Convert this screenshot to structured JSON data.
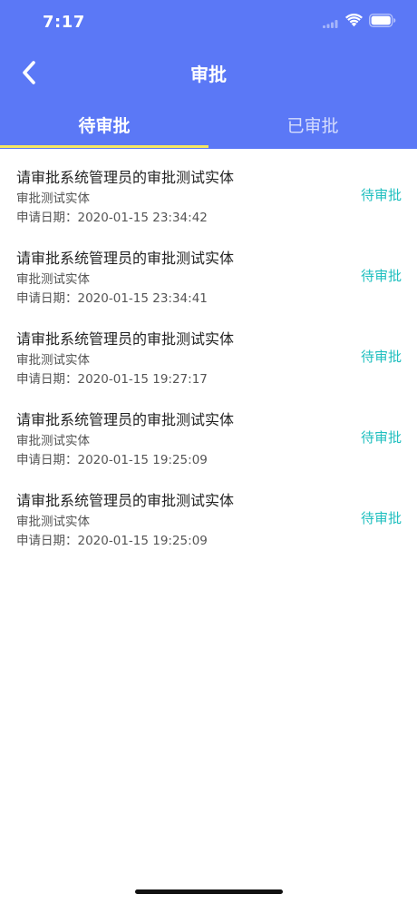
{
  "status_bar": {
    "time": "7:17"
  },
  "header": {
    "title": "审批",
    "back_icon": "chevron-left-icon"
  },
  "tabs": [
    {
      "label": "待审批",
      "active": true
    },
    {
      "label": "已审批",
      "active": false
    }
  ],
  "colors": {
    "header_bg": "#5b78f6",
    "tab_indicator": "#f5e663",
    "status_text": "#1fbfbf"
  },
  "items": [
    {
      "title": "请审批系统管理员的审批测试实体",
      "subtitle": "审批测试实体",
      "date": "申请日期：2020-01-15 23:34:42",
      "status": "待审批"
    },
    {
      "title": "请审批系统管理员的审批测试实体",
      "subtitle": "审批测试实体",
      "date": "申请日期：2020-01-15 23:34:41",
      "status": "待审批"
    },
    {
      "title": "请审批系统管理员的审批测试实体",
      "subtitle": "审批测试实体",
      "date": "申请日期：2020-01-15 19:27:17",
      "status": "待审批"
    },
    {
      "title": "请审批系统管理员的审批测试实体",
      "subtitle": "审批测试实体",
      "date": "申请日期：2020-01-15 19:25:09",
      "status": "待审批"
    },
    {
      "title": "请审批系统管理员的审批测试实体",
      "subtitle": "审批测试实体",
      "date": "申请日期：2020-01-15 19:25:09",
      "status": "待审批"
    }
  ]
}
